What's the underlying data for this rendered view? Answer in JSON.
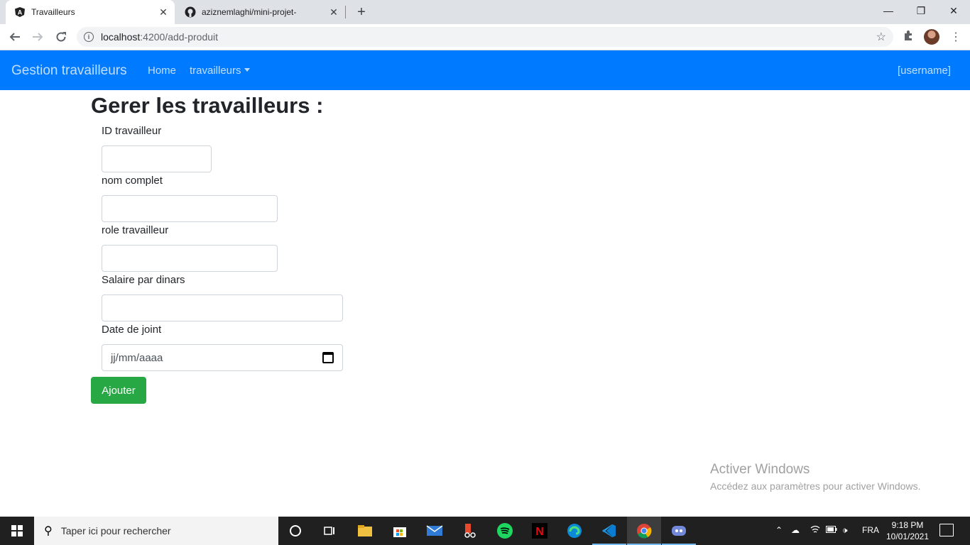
{
  "browser": {
    "tabs": [
      {
        "title": "Travailleurs",
        "icon": "angular-icon"
      },
      {
        "title": "aziznemlaghi/mini-projet-",
        "icon": "github-icon"
      }
    ],
    "url_host": "localhost",
    "url_path": ":4200/add-produit"
  },
  "navbar": {
    "brand": "Gestion travailleurs",
    "home": "Home",
    "dropdown": "travailleurs",
    "user": "[username]"
  },
  "form": {
    "title": "Gerer les travailleurs :",
    "fields": [
      {
        "label": "ID travailleur",
        "value": ""
      },
      {
        "label": "nom complet",
        "value": ""
      },
      {
        "label": "role travailleur",
        "value": ""
      },
      {
        "label": "Salaire par dinars",
        "value": ""
      },
      {
        "label": "Date de joint",
        "placeholder": "jj/mm/aaaa"
      }
    ],
    "submit": "Ajouter"
  },
  "watermark": {
    "title": "Activer Windows",
    "subtitle": "Accédez aux paramètres pour activer Windows."
  },
  "taskbar": {
    "search_placeholder": "Taper ici pour rechercher",
    "language": "FRA",
    "time": "9:18 PM",
    "date": "10/01/2021"
  }
}
